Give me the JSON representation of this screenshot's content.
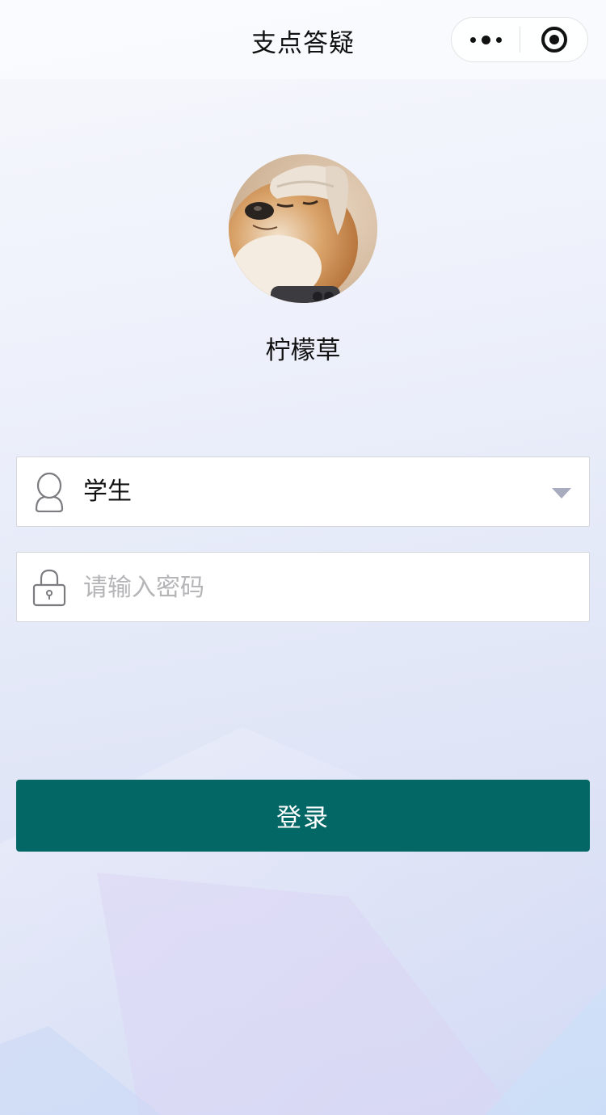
{
  "navbar": {
    "title": "支点答疑",
    "more_icon": "more-dots-icon",
    "close_icon": "target-circle-icon"
  },
  "profile": {
    "avatar_description": "dog-avatar",
    "name": "柠檬草"
  },
  "form": {
    "role": {
      "icon": "user-icon",
      "value": "学生",
      "dropdown_icon": "caret-down-icon"
    },
    "password": {
      "icon": "lock-icon",
      "value": "",
      "placeholder": "请输入密码"
    }
  },
  "login_button": {
    "label": "登录",
    "color": "#036766"
  }
}
